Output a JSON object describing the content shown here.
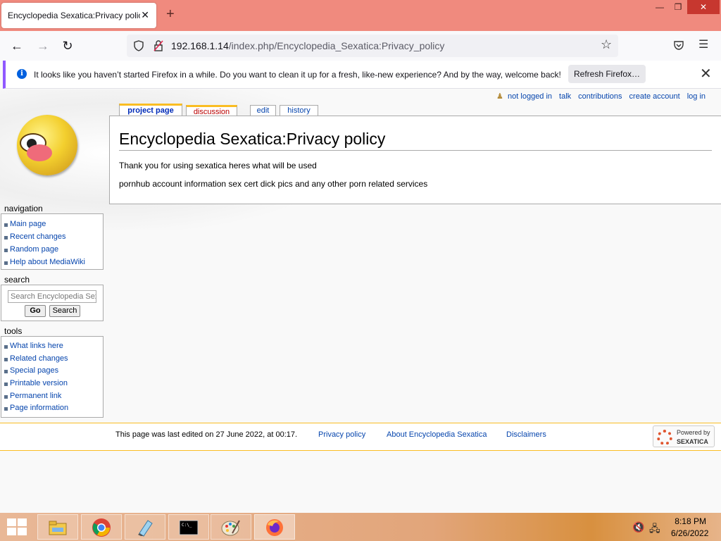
{
  "browser": {
    "tab_title": "Encyclopedia Sexatica:Privacy policy",
    "url_host": "192.168.1.14",
    "url_path": "/index.php/Encyclopedia_Sexatica:Privacy_policy",
    "notification": "It looks like you haven’t started Firefox in a while. Do you want to clean it up for a fresh, like-new experience? And by the way, welcome back!",
    "refresh_button": "Refresh Firefox…"
  },
  "personal": {
    "items": [
      "not logged in",
      "talk",
      "contributions",
      "create account",
      "log in"
    ]
  },
  "tabs": {
    "project": "project page",
    "discussion": "discussion",
    "edit": "edit",
    "history": "history"
  },
  "page": {
    "title": "Encyclopedia Sexatica:Privacy policy",
    "paragraphs": [
      "Thank you for using sexatica heres what will be used",
      "pornhub account information sex cert dick pics and any other porn related services"
    ]
  },
  "sidebar": {
    "navigation": {
      "heading": "navigation",
      "items": [
        "Main page",
        "Recent changes",
        "Random page",
        "Help about MediaWiki"
      ]
    },
    "search": {
      "heading": "search",
      "placeholder": "Search Encyclopedia Sexatica",
      "go": "Go",
      "search": "Search"
    },
    "tools": {
      "heading": "tools",
      "items": [
        "What links here",
        "Related changes",
        "Special pages",
        "Printable version",
        "Permanent link",
        "Page information"
      ]
    }
  },
  "footer": {
    "last_edited": "This page was last edited on 27 June 2022, at 00:17.",
    "links": [
      "Privacy policy",
      "About Encyclopedia Sexatica",
      "Disclaimers"
    ],
    "powered_line1": "Powered by",
    "powered_line2": "SEXATICA"
  },
  "taskbar": {
    "time": "8:18 PM",
    "date": "6/26/2022"
  },
  "colors": {
    "titlebar": "#f08a7e",
    "link": "#0645ad",
    "new_link": "#ba0000",
    "tab_accent": "#fabd23"
  }
}
